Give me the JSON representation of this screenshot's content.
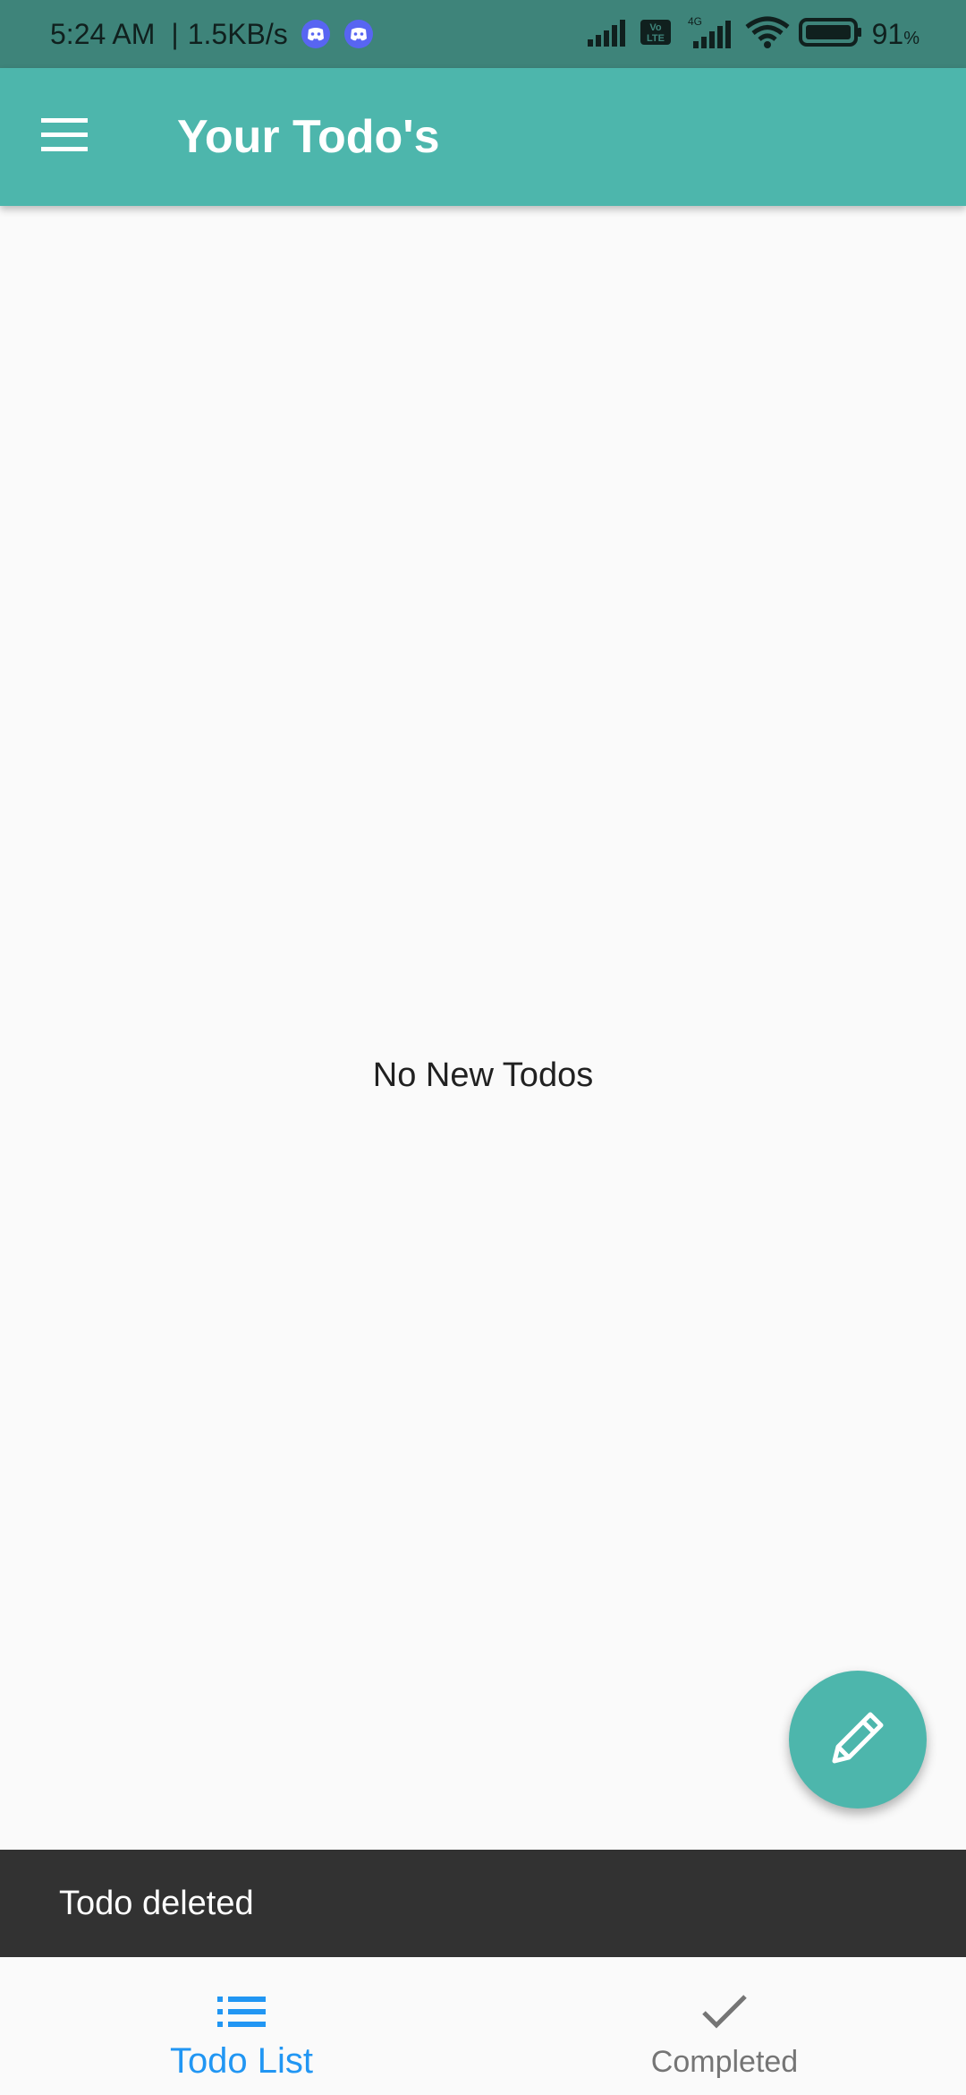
{
  "status_bar": {
    "time": "5:24 AM",
    "separator": "|",
    "network_speed": "1.5KB/s",
    "icons": [
      "discord-icon",
      "discord-icon",
      "signal-icon",
      "volte-icon",
      "signal-4g-icon",
      "wifi-icon",
      "battery-icon"
    ],
    "volte_label": "Vo LTE",
    "network_type": "4G",
    "battery_percent": "91",
    "battery_unit": "%"
  },
  "app_bar": {
    "menu_icon": "menu-icon",
    "title": "Your Todo's"
  },
  "main": {
    "empty_message": "No New Todos"
  },
  "fab": {
    "icon": "pencil-icon"
  },
  "snackbar": {
    "message": "Todo deleted"
  },
  "bottom_nav": {
    "items": [
      {
        "label": "Todo List",
        "icon": "list-icon",
        "active": true
      },
      {
        "label": "Completed",
        "icon": "check-icon",
        "active": false
      }
    ]
  },
  "colors": {
    "status_bar": "#3e847a",
    "app_bar": "#4db6ac",
    "accent_active": "#2196f3",
    "inactive": "#757575",
    "snackbar": "#323232",
    "background": "#fafafa"
  }
}
